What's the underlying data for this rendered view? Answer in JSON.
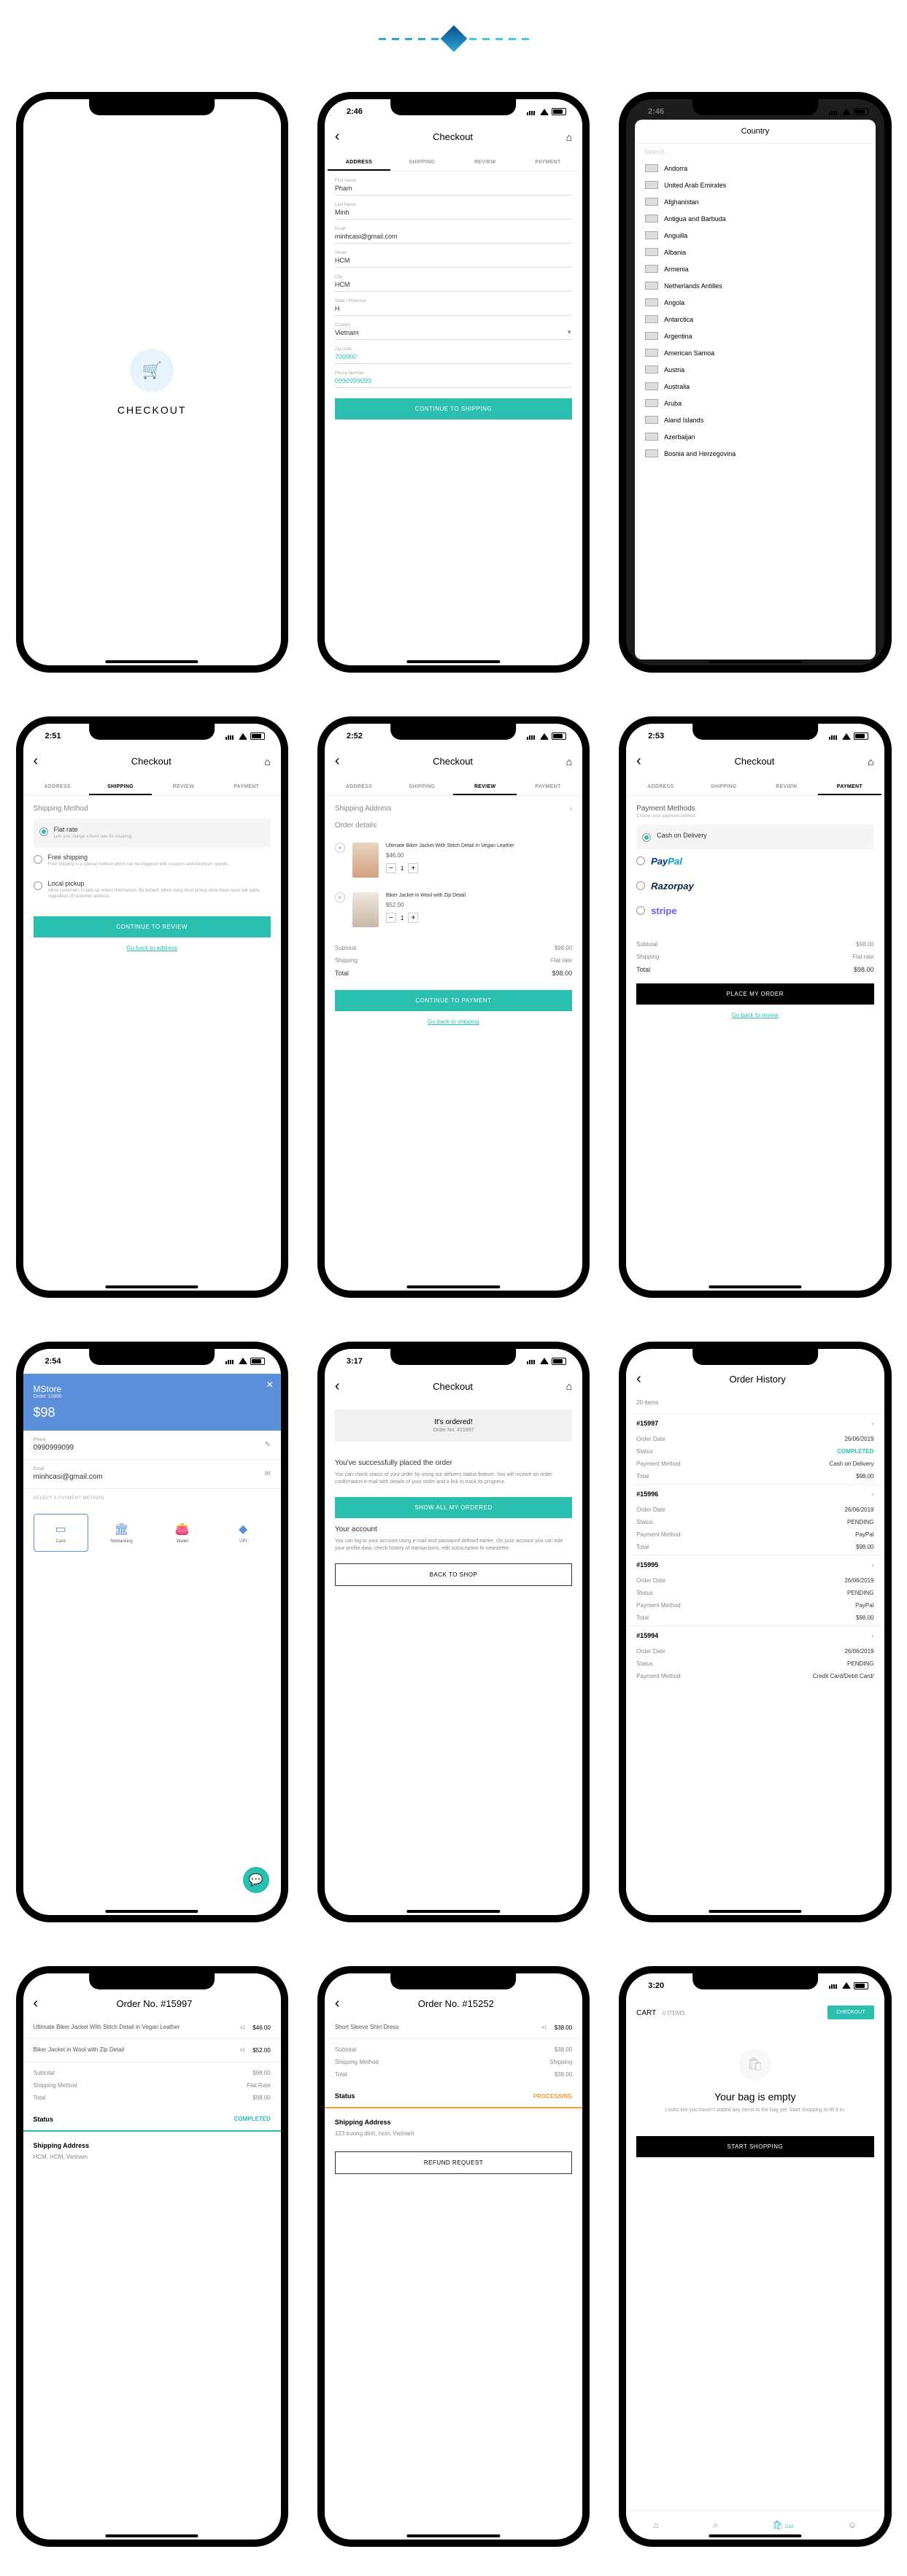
{
  "header": {
    "title": "Checkout"
  },
  "time": {
    "s1": "2:46",
    "s2": "2:46",
    "s3": "2:51",
    "s4": "2:52",
    "s5": "2:53",
    "s6": "2:54",
    "s7": "3:17",
    "s8": "3:20"
  },
  "nav": {
    "back": "‹",
    "checkout": "Checkout",
    "home": "⌂"
  },
  "tabs": {
    "address": "ADDRESS",
    "shipping": "SHIPPING",
    "review": "REVIEW",
    "payment": "PAYMENT"
  },
  "splash": {
    "title": "CHECKOUT"
  },
  "addr": {
    "firstname_lbl": "First Name",
    "firstname": "Pham",
    "lastname_lbl": "Last Name",
    "lastname": "Minh",
    "email_lbl": "Email",
    "email": "minhcasi@gmail.com",
    "street_lbl": "Street",
    "street": "HCM",
    "city_lbl": "City",
    "city": "HCM",
    "state_lbl": "State / Province",
    "state": "H",
    "country_lbl": "Country",
    "country": "Vietnam",
    "zip_lbl": "Zip-code",
    "zip": "700000",
    "phone_lbl": "Phone Number",
    "phone": "0990999099",
    "btn": "CONTINUE TO SHIPPING"
  },
  "country_modal": {
    "title": "Country",
    "search": "Search...",
    "items": [
      "Andorra",
      "United Arab Emirates",
      "Afghanistan",
      "Antigua and Barbuda",
      "Anguilla",
      "Albania",
      "Armenia",
      "Netherlands Antilles",
      "Angola",
      "Antarctica",
      "Argentina",
      "American Samoa",
      "Austria",
      "Australia",
      "Aruba",
      "Aland Islands",
      "Azerbaijan",
      "Bosnia and Herzegovina"
    ]
  },
  "shipping": {
    "title": "Shipping Method",
    "flat": {
      "name": "Flat rate",
      "desc": "Lets you charge a fixed rate for shipping."
    },
    "free": {
      "name": "Free shipping",
      "desc": "Free shipping is a special method which can be triggered with coupons and minimum spends."
    },
    "local": {
      "name": "Local pickup",
      "desc": "Allow customers to pick up orders themselves. By default, when using local pickup store base taxes will apply regardless of customer address."
    },
    "btn": "CONTINUE TO REVIEW",
    "back": "Go back to address"
  },
  "review": {
    "ship_addr": "Shipping Address",
    "order_details": "Order details",
    "p1": {
      "name": "Ultimate Biker Jacket With Stitch Detail in Vegan Leather",
      "price": "$46.00"
    },
    "p2": {
      "name": "Biker Jacket in Wool with Zip Detail",
      "price": "$52.00"
    },
    "subtotal_lbl": "Subtotal",
    "subtotal": "$98.00",
    "ship_lbl": "Shipping",
    "ship": "Flat rate",
    "total_lbl": "Total",
    "total": "$98.00",
    "btn": "CONTINUE TO PAYMENT",
    "back": "Go back to shipping"
  },
  "payment": {
    "title": "Payment Methods",
    "sub": "Choose your payment method",
    "cod": "Cash on Delivery",
    "paypal": "PayPal",
    "razorpay": "Razorpay",
    "stripe": "stripe",
    "subtotal_lbl": "Subtotal",
    "subtotal": "$98.00",
    "ship_lbl": "Shipping",
    "ship": "Flat rate",
    "total_lbl": "Total",
    "total": "$98.00",
    "btn": "PLACE MY ORDER",
    "back": "Go back to review"
  },
  "razorpay": {
    "brand": "MStore",
    "order": "Order 15996",
    "amount": "$98",
    "phone_lbl": "Phone",
    "phone": "0990999099",
    "email_lbl": "Email",
    "email": "minhcasi@gmail.com",
    "select": "SELECT A PAYMENT METHOD",
    "card": "Card",
    "netbanking": "Netbanking",
    "wallet": "Wallet",
    "upi": "UPI"
  },
  "ordered": {
    "box_title": "It's ordered!",
    "box_sub": "Order No. #15997",
    "success_title": "You've successfully placed the order",
    "success_body": "You can check status of your order by using our delivery status feature. You will receive an order confirmation e-mail with details of your order and a link to track its progress.",
    "btn1": "SHOW ALL MY ORDERED",
    "account_title": "Your account",
    "account_body": "You can log to your account using e-mail and password defined earlier. On your account you can edit your profile data, check history of transactions, edit subscription to newsletter.",
    "btn2": "BACK TO SHOP"
  },
  "history": {
    "title": "Order History",
    "count": "20 items",
    "orders": [
      {
        "no": "#15997",
        "date_lbl": "Order Date",
        "date": "26/06/2019",
        "status_lbl": "Status",
        "status": "COMPLETED",
        "pm_lbl": "Payment Method",
        "pm": "Cash on Delivery",
        "total_lbl": "Total",
        "total": "$98.00"
      },
      {
        "no": "#15996",
        "date_lbl": "Order Date",
        "date": "26/06/2019",
        "status_lbl": "Status",
        "status": "PENDING",
        "pm_lbl": "Payment Method",
        "pm": "PayPal",
        "total_lbl": "Total",
        "total": "$98.00"
      },
      {
        "no": "#15995",
        "date_lbl": "Order Date",
        "date": "26/06/2019",
        "status_lbl": "Status",
        "status": "PENDING",
        "pm_lbl": "Payment Method",
        "pm": "PayPal",
        "total_lbl": "Total",
        "total": "$98.00"
      },
      {
        "no": "#15994",
        "date_lbl": "Order Date",
        "date": "26/06/2019",
        "status_lbl": "Status",
        "status": "PENDING",
        "pm_lbl": "Payment Method",
        "pm": "Credit Card/Debit Card/"
      }
    ]
  },
  "detail1": {
    "title": "Order No. #15997",
    "items": [
      {
        "name": "Ultimate Biker Jacket With Stitch Detail in Vegan Leather",
        "qty": "x1",
        "price": "$46.00"
      },
      {
        "name": "Biker Jacket in Wool with Zip Detail",
        "qty": "x1",
        "price": "$52.00"
      }
    ],
    "subtotal_lbl": "Subtotal",
    "subtotal": "$98.00",
    "sm_lbl": "Shipping Method",
    "sm": "Flat Rate",
    "total_lbl": "Total",
    "total": "$98.00",
    "status_lbl": "Status",
    "status": "COMPLETED",
    "ship_title": "Shipping Address",
    "ship_addr": "HCM, HCM, Vietnam"
  },
  "detail2": {
    "title": "Order No. #15252",
    "items": [
      {
        "name": "Short Sleeve Shirt Dress",
        "qty": "x1",
        "price": "$38.00"
      }
    ],
    "subtotal_lbl": "Subtotal",
    "subtotal": "$38.00",
    "sm_lbl": "Shipping Method",
    "sm": "Shipping",
    "total_lbl": "Total",
    "total": "$38.00",
    "status_lbl": "Status",
    "status": "PROCESSING",
    "ship_title": "Shipping Address",
    "ship_addr": "123 truong dinh, hcm, Vietnam",
    "btn": "REFUND REQUEST"
  },
  "cart": {
    "cart": "CART",
    "items": "0 ITEMS",
    "checkout": "CHECKOUT",
    "empty_title": "Your bag is empty",
    "empty_sub": "Looks like you haven't added any items to the bag yet. Start shopping to fill it in.",
    "btn": "START SHOPPING",
    "nav_cart": "Cart"
  }
}
